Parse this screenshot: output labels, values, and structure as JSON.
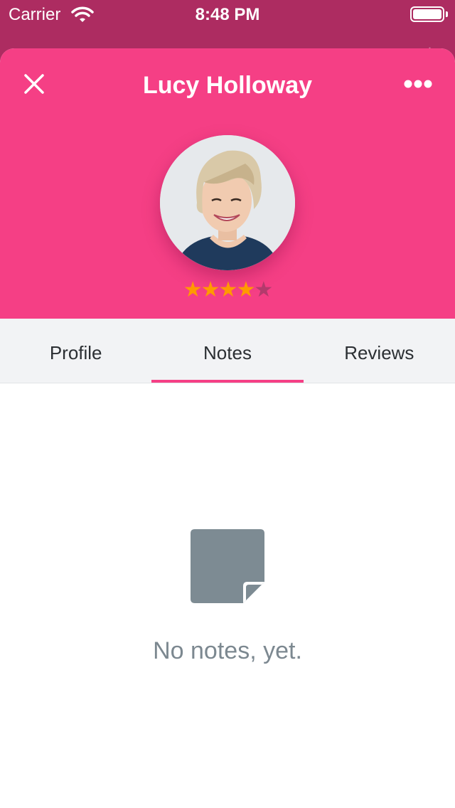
{
  "status_bar": {
    "carrier": "Carrier",
    "time": "8:48 PM",
    "wifi_icon": "wifi-icon",
    "battery_icon": "battery-icon"
  },
  "header": {
    "title": "Lucy Holloway",
    "close_icon": "close-icon",
    "more_icon": "more-horizontal-icon",
    "background_color": "#f53f85"
  },
  "profile": {
    "avatar": "avatar-photo",
    "rating": 4,
    "rating_max": 5,
    "star_color": "#ff9a00"
  },
  "tabs": [
    {
      "label": "Profile",
      "active": false
    },
    {
      "label": "Notes",
      "active": true
    },
    {
      "label": "Reviews",
      "active": false
    }
  ],
  "empty_state": {
    "icon": "note-icon",
    "message": "No notes, yet."
  }
}
